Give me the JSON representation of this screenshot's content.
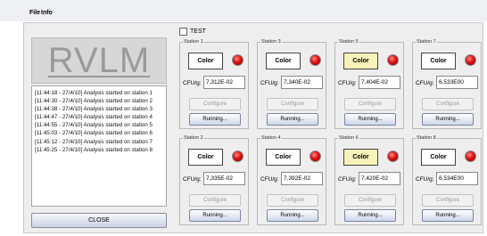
{
  "menubar": {
    "items": [
      "File",
      "Info"
    ]
  },
  "logo_text": "RVLM",
  "log_lines": [
    "[11:44:18 - 27/4/10] Analysis started on station 1",
    "[11:44:30 - 27/4/10] Analysis started on station 2",
    "[11:44:38 - 27/4/10] Analysis started on station 3",
    "[11:44:47 - 27/4/10] Analysis started on station 4",
    "[11:44:55 - 27/4/10] Analysis started on station 5",
    "[11:45:03 - 27/4/10] Analysis started on station 6",
    "[11:45:12 - 27/4/10] Analysis started on station 7",
    "[11:45:25 - 27/4/10] Analysis started on station 8"
  ],
  "close_label": "CLOSE",
  "test_label": "TEST",
  "test_checked": false,
  "stations": [
    {
      "title": "Station 1",
      "color_label": "Color",
      "highlighted": false,
      "cfu_label": "CFU/g:",
      "cfu": "7,312E-02",
      "configure_label": "Configure",
      "running_label": "Running..."
    },
    {
      "title": "Station 3",
      "color_label": "Color",
      "highlighted": false,
      "cfu_label": "CFU/g:",
      "cfu": "7,340E-02",
      "configure_label": "Configure",
      "running_label": "Running..."
    },
    {
      "title": "Station 5",
      "color_label": "Color",
      "highlighted": true,
      "cfu_label": "CFU/g:",
      "cfu": "7,404E-02",
      "configure_label": "Configure",
      "running_label": "Running..."
    },
    {
      "title": "Station 7",
      "color_label": "Color",
      "highlighted": false,
      "cfu_label": "CFU/g:",
      "cfu": "6,533E00",
      "configure_label": "Configure",
      "running_label": "Running..."
    },
    {
      "title": "Station 2",
      "color_label": "Color",
      "highlighted": false,
      "cfu_label": "CFU/g:",
      "cfu": "7,335E-02",
      "configure_label": "Configure",
      "running_label": "Running..."
    },
    {
      "title": "Station 4",
      "color_label": "Color",
      "highlighted": false,
      "cfu_label": "CFU/g:",
      "cfu": "7,392E-02",
      "configure_label": "Configure",
      "running_label": "Running..."
    },
    {
      "title": "Station 6",
      "color_label": "Color",
      "highlighted": true,
      "cfu_label": "CFU/g:",
      "cfu": "7,420E-02",
      "configure_label": "Configure",
      "running_label": "Running..."
    },
    {
      "title": "Station 8",
      "color_label": "Color",
      "highlighted": false,
      "cfu_label": "CFU/g:",
      "cfu": "6,534E00",
      "configure_label": "Configure",
      "running_label": "Running..."
    }
  ],
  "colors": {
    "highlight": "#f7f2b8",
    "led": "#e01010",
    "logo_text": "#9a9a9a"
  }
}
